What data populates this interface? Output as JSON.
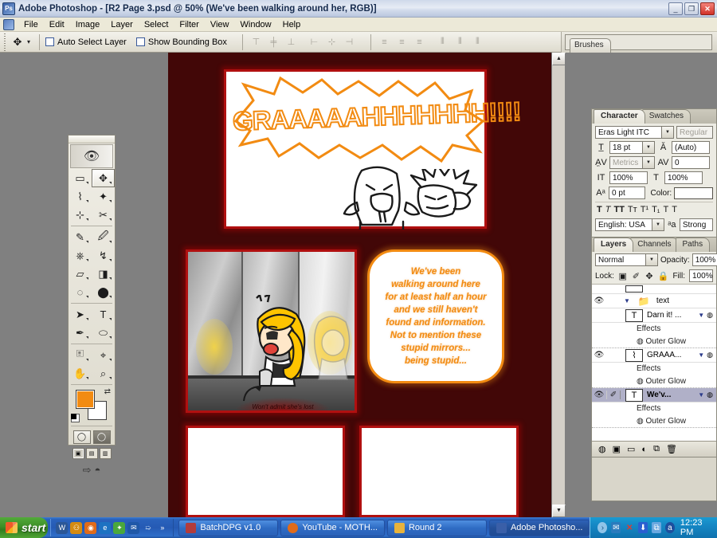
{
  "window": {
    "title": "Adobe Photoshop - [R2 Page 3.psd @ 50% (We've been  walking around her, RGB)]",
    "app_icon": "photoshop-icon",
    "minimize": "_",
    "restore": "❐",
    "close": "✕"
  },
  "menu": {
    "items": [
      "File",
      "Edit",
      "Image",
      "Layer",
      "Select",
      "Filter",
      "View",
      "Window",
      "Help"
    ]
  },
  "options_bar": {
    "tool_icon": "move-tool-icon",
    "tool_dropdown": "▾",
    "auto_select_layer": "Auto Select Layer",
    "show_bounding_box": "Show Bounding Box",
    "align_group_1": [
      "align-top-edges",
      "align-vertical-centers",
      "align-bottom-edges"
    ],
    "align_group_2": [
      "align-left-edges",
      "align-horizontal-centers",
      "align-right-edges"
    ],
    "distribute_group_1": [
      "distribute-top-edges",
      "distribute-vertical-centers",
      "distribute-bottom-edges"
    ],
    "distribute_group_2": [
      "distribute-left-edges",
      "distribute-horizontal-centers",
      "distribute-right-edges"
    ],
    "palette_well_tab": "Brushes"
  },
  "toolbox": {
    "tools": [
      {
        "name": "rectangular-marquee-tool",
        "glyph": "▭"
      },
      {
        "name": "move-tool",
        "glyph": "✥",
        "active": true
      },
      {
        "name": "lasso-tool",
        "glyph": "⌇"
      },
      {
        "name": "magic-wand-tool",
        "glyph": "✦"
      },
      {
        "name": "crop-tool",
        "glyph": "⊹"
      },
      {
        "name": "slice-tool",
        "glyph": "✂"
      },
      {
        "name": "healing-brush-tool",
        "glyph": "✎"
      },
      {
        "name": "brush-tool",
        "glyph": "🖌"
      },
      {
        "name": "clone-stamp-tool",
        "glyph": "⎈"
      },
      {
        "name": "history-brush-tool",
        "glyph": "↯"
      },
      {
        "name": "eraser-tool",
        "glyph": "▱"
      },
      {
        "name": "gradient-tool",
        "glyph": "◨"
      },
      {
        "name": "blur-tool",
        "glyph": "💧"
      },
      {
        "name": "dodge-tool",
        "glyph": "🔦"
      },
      {
        "name": "path-selection-tool",
        "glyph": "➤"
      },
      {
        "name": "type-tool",
        "glyph": "T"
      },
      {
        "name": "pen-tool",
        "glyph": "✒"
      },
      {
        "name": "ellipse-shape-tool",
        "glyph": "⬭"
      },
      {
        "name": "notes-tool",
        "glyph": "🗒"
      },
      {
        "name": "eyedropper-tool",
        "glyph": "⌕"
      },
      {
        "name": "hand-tool",
        "glyph": "✋"
      },
      {
        "name": "zoom-tool",
        "glyph": "🔍"
      }
    ],
    "foreground_color": "#F28B12",
    "background_color": "#FFFFFF",
    "swap_colors": "⇄",
    "screen_modes": [
      "standard-screen-mode",
      "full-screen-with-menubar",
      "full-screen-mode"
    ],
    "jump_to_imageready": "jump-to-imageready-icon"
  },
  "character_panel": {
    "tabs": [
      "Character",
      "Swatches"
    ],
    "active_tab": "Character",
    "font_family": "Eras Light ITC",
    "font_style": "Regular",
    "font_size": "18 pt",
    "leading": "(Auto)",
    "kerning": "Metrics",
    "tracking": "0",
    "vertical_scale": "100%",
    "horizontal_scale": "100%",
    "baseline_shift": "0 pt",
    "color_label": "Color:",
    "text_color": "#FFFFFF",
    "styles": [
      "T",
      "T",
      "TT",
      "Tt",
      "T¹",
      "T₁",
      "T",
      "T"
    ],
    "language": "English: USA",
    "anti_alias": "Strong",
    "anti_alias_icon": "anti-alias-icon"
  },
  "layers_panel": {
    "tabs": [
      "Layers",
      "Channels",
      "Paths"
    ],
    "active_tab": "Layers",
    "blend_mode": "Normal",
    "opacity_label": "Opacity:",
    "opacity_value": "100%",
    "lock_label": "Lock:",
    "lock_icons": [
      "lock-transparent-pixels",
      "lock-image-pixels",
      "lock-position",
      "lock-all"
    ],
    "fill_label": "Fill:",
    "fill_value": "100%",
    "rows": [
      {
        "type": "group",
        "name": "text",
        "visible": true,
        "expanded": true,
        "icon": "folder-icon"
      },
      {
        "type": "layer",
        "name": "Darn it! ...",
        "visible": false,
        "icon": "type-layer-icon",
        "has_fx": true,
        "selected": false
      },
      {
        "type": "effects-header",
        "name": "Effects"
      },
      {
        "type": "effect",
        "name": "Outer Glow"
      },
      {
        "type": "layer",
        "name": "GRAAA...",
        "visible": true,
        "icon": "shape-layer-icon",
        "has_fx": true,
        "selected": false
      },
      {
        "type": "effects-header",
        "name": "Effects"
      },
      {
        "type": "effect",
        "name": "Outer Glow"
      },
      {
        "type": "layer",
        "name": "We'v...",
        "visible": true,
        "icon": "type-layer-icon",
        "has_fx": true,
        "selected": true,
        "linked": true
      },
      {
        "type": "effects-header",
        "name": "Effects"
      },
      {
        "type": "effect",
        "name": "Outer Glow"
      }
    ],
    "footer_buttons": [
      "add-layer-style",
      "add-layer-mask",
      "new-group",
      "new-adjustment-layer",
      "new-layer",
      "delete-layer"
    ]
  },
  "document": {
    "background_color": "#420707",
    "panel_border_color": "#B01010",
    "accent_color": "#F28B12",
    "shout_text": "GRAAAAAHHHHHHH!!!!",
    "speech_bubble_lines": [
      "We've been",
      "walking around here",
      "for at least half an hour",
      "and we still haven't",
      "found and information.",
      "Not to mention these",
      "stupid mirrors...",
      "being stupid..."
    ],
    "small_caption": "Won't admit she's lost",
    "panels": [
      "shout-panel",
      "mirror-panel",
      "speech-bubble-panel",
      "empty-panel-bottom-left",
      "empty-panel-bottom-right"
    ]
  },
  "taskbar": {
    "start_label": "start",
    "quick_launch": [
      {
        "name": "ql-word-icon",
        "glyph": "W",
        "color": "#2b5797"
      },
      {
        "name": "ql-person-icon",
        "glyph": "⚇",
        "color": "#d58b12"
      },
      {
        "name": "ql-firefox-icon",
        "glyph": "◉",
        "color": "#e06b1a"
      },
      {
        "name": "ql-internet-explorer-icon",
        "glyph": "e",
        "color": "#1d72c2"
      },
      {
        "name": "ql-messenger-icon",
        "glyph": "✦",
        "color": "#4aa83c"
      },
      {
        "name": "ql-outlook-icon",
        "glyph": "✉",
        "color": "#1f58a8"
      },
      {
        "name": "ql-show-desktop-icon",
        "glyph": "➯",
        "color": "#7d7d7d"
      },
      {
        "name": "ql-expand-icon",
        "glyph": "»",
        "color": "#ffffff"
      }
    ],
    "tasks": [
      {
        "name": "taskbar-item-batchdpg",
        "label": "BatchDPG v1.0",
        "icon_color": "#b23c3c",
        "active": false
      },
      {
        "name": "taskbar-item-youtube",
        "label": "YouTube - MOTH...",
        "icon_color": "#e06b1a",
        "active": false
      },
      {
        "name": "taskbar-item-round2",
        "label": "Round 2",
        "icon_color": "#e8b33c",
        "active": false
      },
      {
        "name": "taskbar-item-photoshop",
        "label": "Adobe Photosho...",
        "icon_color": "#3a5fa8",
        "active": true
      }
    ],
    "tray": [
      {
        "name": "tray-expand-icon",
        "glyph": "›",
        "color": "#a9d6ef"
      },
      {
        "name": "tray-messenger-icon",
        "glyph": "✉",
        "color": "#2a7bbd"
      },
      {
        "name": "tray-close-red-icon",
        "glyph": "✕",
        "color": "#e03b2c"
      },
      {
        "name": "tray-update-icon",
        "glyph": "⬇",
        "color": "#2a5fd0"
      },
      {
        "name": "tray-network-icon",
        "glyph": "🖧",
        "color": "#6aa8e0"
      },
      {
        "name": "tray-aim-icon",
        "glyph": "a",
        "color": "#1c4f9e"
      }
    ],
    "clock": "12:23 PM"
  }
}
